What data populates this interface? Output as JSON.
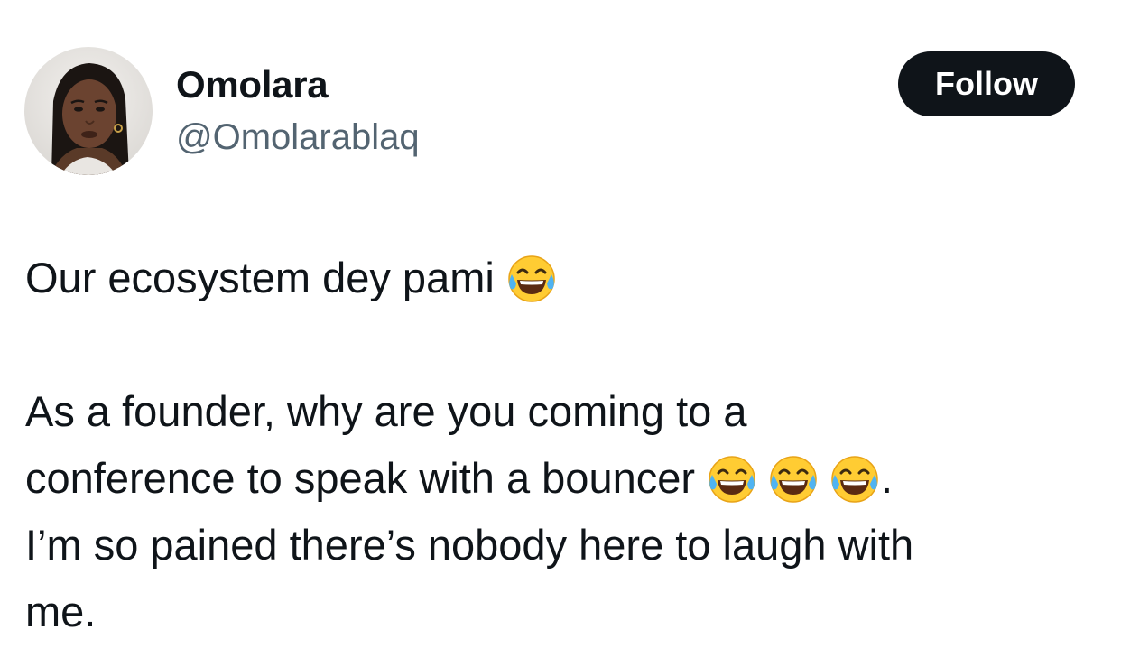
{
  "tweet": {
    "author": {
      "display_name": "Omolara",
      "handle": "@Omolarablaq",
      "avatar_icon": "profile-photo"
    },
    "follow_label": "Follow",
    "lines": {
      "l1": "Our ecosystem dey pami",
      "l2": "As a founder, why are you coming to a",
      "l3": "conference to speak with a bouncer",
      "l3_end": ".",
      "l4": "I’m so pained there’s nobody here to laugh with",
      "l5": "me."
    },
    "emoji": "face-with-tears-of-joy",
    "colors": {
      "text": "#0f1419",
      "secondary_text": "#536471",
      "follow_bg": "#0f1419",
      "follow_text": "#ffffff",
      "background": "#ffffff"
    }
  }
}
